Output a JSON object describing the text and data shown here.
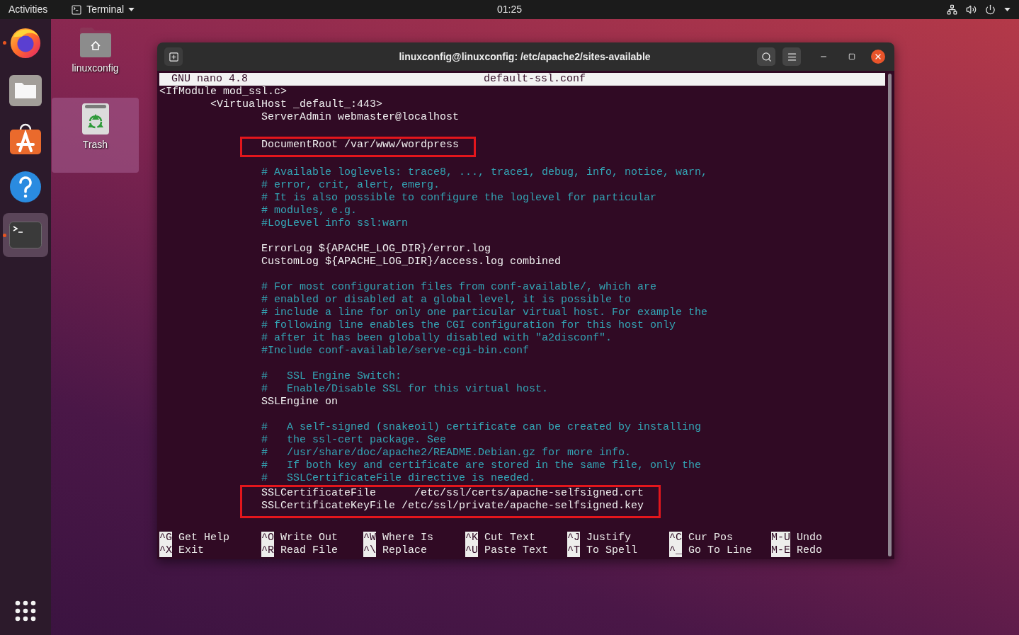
{
  "top_bar": {
    "activities": "Activities",
    "app_menu": "Terminal",
    "clock": "01:25"
  },
  "dock": {
    "items": [
      {
        "kind": "browser",
        "running": true,
        "selected": false
      },
      {
        "kind": "files",
        "running": false,
        "selected": false
      },
      {
        "kind": "software",
        "running": false,
        "selected": false
      },
      {
        "kind": "help",
        "running": false,
        "selected": false
      },
      {
        "kind": "terminal",
        "running": true,
        "selected": true
      }
    ]
  },
  "desktop": {
    "icons": [
      {
        "kind": "home",
        "label": "linuxconfig",
        "selected": false
      },
      {
        "kind": "trash",
        "label": "Trash",
        "selected": true
      }
    ]
  },
  "terminal": {
    "title": "linuxconfig@linuxconfig: /etc/apache2/sites-available",
    "nano": {
      "version": "GNU nano 4.8",
      "filename": "default-ssl.conf"
    },
    "lines": [
      {
        "kind": "directive",
        "text": "<IfModule mod_ssl.c>",
        "highlighted": false,
        "children": [
          {
            "kind": "directive",
            "text": "<VirtualHost _default_:443>",
            "highlighted": false,
            "children": [
              {
                "kind": "directive",
                "text": "ServerAdmin webmaster@localhost",
                "highlighted": false
              },
              {
                "kind": "blank",
                "highlighted": false
              },
              {
                "kind": "directive",
                "text": "DocumentRoot /var/www/wordpress",
                "highlighted": true
              },
              {
                "kind": "blank",
                "highlighted": false
              },
              {
                "kind": "comment",
                "text": "# Available loglevels: trace8, ..., trace1, debug, info, notice, warn,",
                "highlighted": false
              },
              {
                "kind": "comment",
                "text": "# error, crit, alert, emerg.",
                "highlighted": false
              },
              {
                "kind": "comment",
                "text": "# It is also possible to configure the loglevel for particular",
                "highlighted": false
              },
              {
                "kind": "comment",
                "text": "# modules, e.g.",
                "highlighted": false
              },
              {
                "kind": "comment",
                "text": "#LogLevel info ssl:warn",
                "highlighted": false
              },
              {
                "kind": "blank",
                "highlighted": false
              },
              {
                "kind": "directive",
                "text": "ErrorLog ${APACHE_LOG_DIR}/error.log",
                "highlighted": false
              },
              {
                "kind": "directive",
                "text": "CustomLog ${APACHE_LOG_DIR}/access.log combined",
                "highlighted": false
              },
              {
                "kind": "blank",
                "highlighted": false
              },
              {
                "kind": "comment",
                "text": "# For most configuration files from conf-available/, which are",
                "highlighted": false
              },
              {
                "kind": "comment",
                "text": "# enabled or disabled at a global level, it is possible to",
                "highlighted": false
              },
              {
                "kind": "comment",
                "text": "# include a line for only one particular virtual host. For example the",
                "highlighted": false
              },
              {
                "kind": "comment",
                "text": "# following line enables the CGI configuration for this host only",
                "highlighted": false
              },
              {
                "kind": "comment",
                "text": "# after it has been globally disabled with \"a2disconf\".",
                "highlighted": false
              },
              {
                "kind": "comment",
                "text": "#Include conf-available/serve-cgi-bin.conf",
                "highlighted": false
              },
              {
                "kind": "blank",
                "highlighted": false
              },
              {
                "kind": "comment",
                "text": "#   SSL Engine Switch:",
                "highlighted": false
              },
              {
                "kind": "comment",
                "text": "#   Enable/Disable SSL for this virtual host.",
                "highlighted": false
              },
              {
                "kind": "directive",
                "text": "SSLEngine on",
                "highlighted": false
              },
              {
                "kind": "blank",
                "highlighted": false
              },
              {
                "kind": "comment",
                "text": "#   A self-signed (snakeoil) certificate can be created by installing",
                "highlighted": false
              },
              {
                "kind": "comment",
                "text": "#   the ssl-cert package. See",
                "highlighted": false
              },
              {
                "kind": "comment",
                "text": "#   /usr/share/doc/apache2/README.Debian.gz for more info.",
                "highlighted": false
              },
              {
                "kind": "comment",
                "text": "#   If both key and certificate are stored in the same file, only the",
                "highlighted": false
              },
              {
                "kind": "comment",
                "text": "#   SSLCertificateFile directive is needed.",
                "highlighted": false
              },
              {
                "kind": "directive",
                "text": "SSLCertificateFile      /etc/ssl/certs/apache-selfsigned.crt",
                "highlighted": true
              },
              {
                "kind": "directive",
                "text": "SSLCertificateKeyFile /etc/ssl/private/apache-selfsigned.key",
                "highlighted": true
              }
            ]
          }
        ]
      }
    ],
    "shortcut_rows": [
      [
        {
          "key": "^G",
          "label": "Get Help"
        },
        {
          "key": "^O",
          "label": "Write Out"
        },
        {
          "key": "^W",
          "label": "Where Is"
        },
        {
          "key": "^K",
          "label": "Cut Text"
        },
        {
          "key": "^J",
          "label": "Justify"
        },
        {
          "key": "^C",
          "label": "Cur Pos"
        },
        {
          "key": "M-U",
          "label": "Undo"
        }
      ],
      [
        {
          "key": "^X",
          "label": "Exit"
        },
        {
          "key": "^R",
          "label": "Read File"
        },
        {
          "key": "^\\",
          "label": "Replace"
        },
        {
          "key": "^U",
          "label": "Paste Text"
        },
        {
          "key": "^T",
          "label": "To Spell"
        },
        {
          "key": "^_",
          "label": "Go To Line"
        },
        {
          "key": "M-E",
          "label": "Redo"
        }
      ]
    ]
  }
}
